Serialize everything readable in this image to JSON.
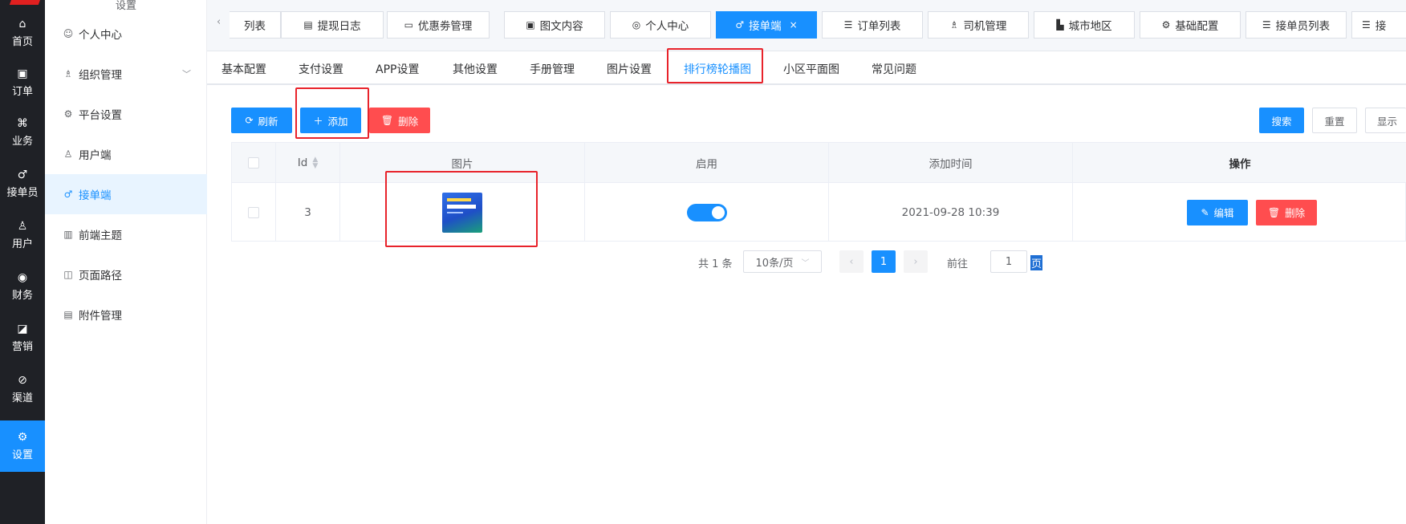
{
  "rail": {
    "items": [
      {
        "icon": "⌂",
        "label": "首页"
      },
      {
        "icon": "▣",
        "label": "订单"
      },
      {
        "icon": "⌘",
        "label": "业务"
      },
      {
        "icon": "♂",
        "label": "接单员"
      },
      {
        "icon": "♙",
        "label": "用户"
      },
      {
        "icon": "◉",
        "label": "财务"
      },
      {
        "icon": "◪",
        "label": "营销"
      },
      {
        "icon": "⊘",
        "label": "渠道"
      },
      {
        "icon": "⚙",
        "label": "设置"
      }
    ]
  },
  "sidebar": {
    "title": "设置",
    "items": [
      {
        "icon": "☺",
        "label": "个人中心"
      },
      {
        "icon": "♗",
        "label": "组织管理"
      },
      {
        "icon": "⚙",
        "label": "平台设置"
      },
      {
        "icon": "♙",
        "label": "用户端"
      },
      {
        "icon": "♂",
        "label": "接单端"
      },
      {
        "icon": "▥",
        "label": "前端主题"
      },
      {
        "icon": "◫",
        "label": "页面路径"
      },
      {
        "icon": "▤",
        "label": "附件管理"
      }
    ]
  },
  "tabs": {
    "prev_icon": "‹",
    "items": [
      {
        "icon": "",
        "label": "列表"
      },
      {
        "icon": "▤",
        "label": "提现日志"
      },
      {
        "icon": "▭",
        "label": "优惠劵管理"
      },
      {
        "icon": "▣",
        "label": "图文内容"
      },
      {
        "icon": "◎",
        "label": "个人中心"
      },
      {
        "icon": "♂",
        "label": "接单端"
      },
      {
        "icon": "☰",
        "label": "订单列表"
      },
      {
        "icon": "♗",
        "label": "司机管理"
      },
      {
        "icon": "▙",
        "label": "城市地区"
      },
      {
        "icon": "⚙",
        "label": "基础配置"
      },
      {
        "icon": "☰",
        "label": "接单员列表"
      },
      {
        "icon": "☰",
        "label": "接"
      }
    ],
    "close_icon": "×"
  },
  "subtabs": [
    "基本配置",
    "支付设置",
    "APP设置",
    "其他设置",
    "手册管理",
    "图片设置",
    "排行榜轮播图",
    "小区平面图",
    "常见问题"
  ],
  "toolbar": {
    "refresh": "刷新",
    "add": "添加",
    "delete": "删除",
    "search": "搜索",
    "reset": "重置",
    "display": "显示"
  },
  "table": {
    "headers": {
      "id": "Id",
      "image": "图片",
      "enabled": "启用",
      "time": "添加时间",
      "actions": "操作"
    },
    "rows": [
      {
        "id": "3",
        "time": "2021-09-28 10:39",
        "edit": "编辑",
        "delete": "删除"
      }
    ]
  },
  "pager": {
    "total": "共 1 条",
    "page_size": "10条/页",
    "current": "1",
    "goto_label": "前往",
    "goto_value": "1",
    "suffix": "页"
  },
  "colors": {
    "primary": "#1890ff",
    "danger": "#ff4d4f",
    "rail": "#1f2126",
    "highlight": "#e8232b"
  }
}
